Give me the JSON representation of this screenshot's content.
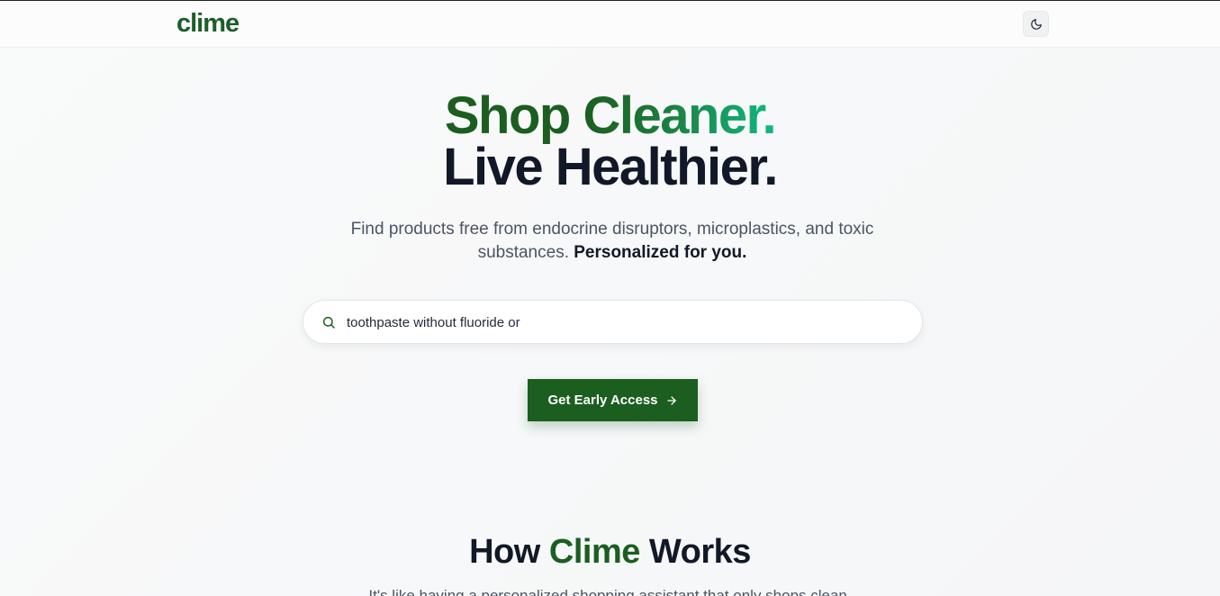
{
  "header": {
    "logo": "clime",
    "theme_toggle_icon": "moon-icon"
  },
  "hero": {
    "title_part1": "Shop ",
    "title_part2": "Cleaner.",
    "title_line2": "Live Healthier.",
    "subtitle": "Find products free from endocrine disruptors, microplastics, and toxic substances. ",
    "subtitle_bold": "Personalized for you."
  },
  "search": {
    "icon": "search-icon",
    "value": "toothpaste without fluoride or",
    "placeholder": ""
  },
  "cta": {
    "label": "Get Early Access",
    "icon": "arrow-right-icon"
  },
  "how": {
    "title_pre": "How ",
    "title_brand": "Clime",
    "title_post": " Works",
    "subtitle": "It's like having a personalized shopping assistant that only shops clean."
  },
  "colors": {
    "brand_green": "#1b5e20",
    "gradient_end": "#10b981",
    "text_dark": "#111827",
    "text_muted": "#4b5563"
  }
}
